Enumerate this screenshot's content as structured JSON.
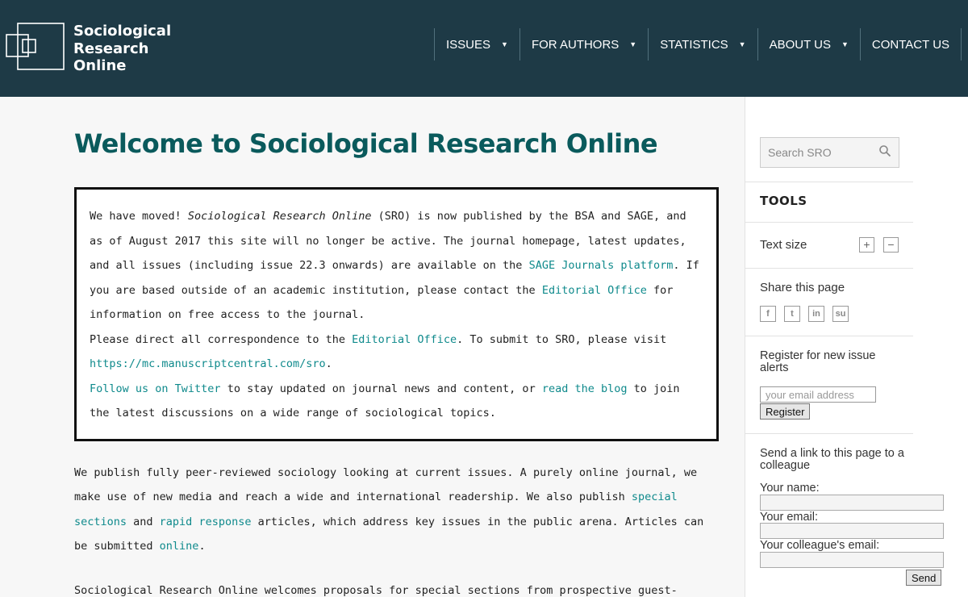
{
  "header": {
    "logo_lines": [
      "Sociological",
      "Research",
      "Online"
    ],
    "nav": [
      {
        "label": "ISSUES",
        "caret": "▼"
      },
      {
        "label": "FOR AUTHORS",
        "caret": "▼"
      },
      {
        "label": "STATISTICS",
        "caret": "▼"
      },
      {
        "label": "ABOUT US",
        "caret": "▼"
      },
      {
        "label": "CONTACT US",
        "caret": ""
      }
    ]
  },
  "main": {
    "title": "Welcome to Sociological Research Online",
    "notice": {
      "p1_a": "We have moved! ",
      "p1_journal": "Sociological Research Online",
      "p1_b": " (SRO) is now published by the BSA and SAGE, and as of August 2017 this site will no longer be active. The journal homepage, latest updates, and all issues (including issue 22.3 onwards) are available on the ",
      "p1_link1": "SAGE Journals platform",
      "p1_c": ". If you are based outside of an academic institution, please contact the ",
      "p1_link2": "Editorial Office",
      "p1_d": " for information on free access to the journal.",
      "p2_a": "Please direct all correspondence to the ",
      "p2_link1": "Editorial Office",
      "p2_b": ". To submit to SRO, please visit ",
      "p2_link2": "https://mc.manuscriptcentral.com/sro",
      "p2_c": ".",
      "p3_link1": "Follow us on Twitter",
      "p3_a": " to stay updated on journal news and content, or ",
      "p3_link2": "read the blog",
      "p3_b": " to join the latest discussions on a wide range of sociological topics."
    },
    "intro": {
      "a": "We publish fully peer-reviewed sociology looking at current issues. A purely online journal, we make use of new media and reach a wide and international readership. We also publish ",
      "link1": "special sections",
      "b": " and ",
      "link2": "rapid response",
      "c": " articles, which address key issues in the public arena. Articles can be submitted ",
      "link3": "online",
      "d": "."
    },
    "intro2": "Sociological Research Online welcomes proposals for special sections from prospective guest-"
  },
  "sidebar": {
    "search_placeholder": "Search SRO",
    "tools_title": "TOOLS",
    "text_size_label": "Text size",
    "increase": "+",
    "decrease": "−",
    "share_label": "Share this page",
    "share_icons": [
      "f",
      "t",
      "in",
      "su"
    ],
    "register_label": "Register for new issue alerts",
    "email_placeholder": "your email address",
    "register_button": "Register",
    "send_label": "Send a link to this page to a colleague",
    "your_name_label": "Your name:",
    "your_email_label": "Your email:",
    "colleague_email_label": "Your colleague's email:",
    "send_button": "Send"
  }
}
